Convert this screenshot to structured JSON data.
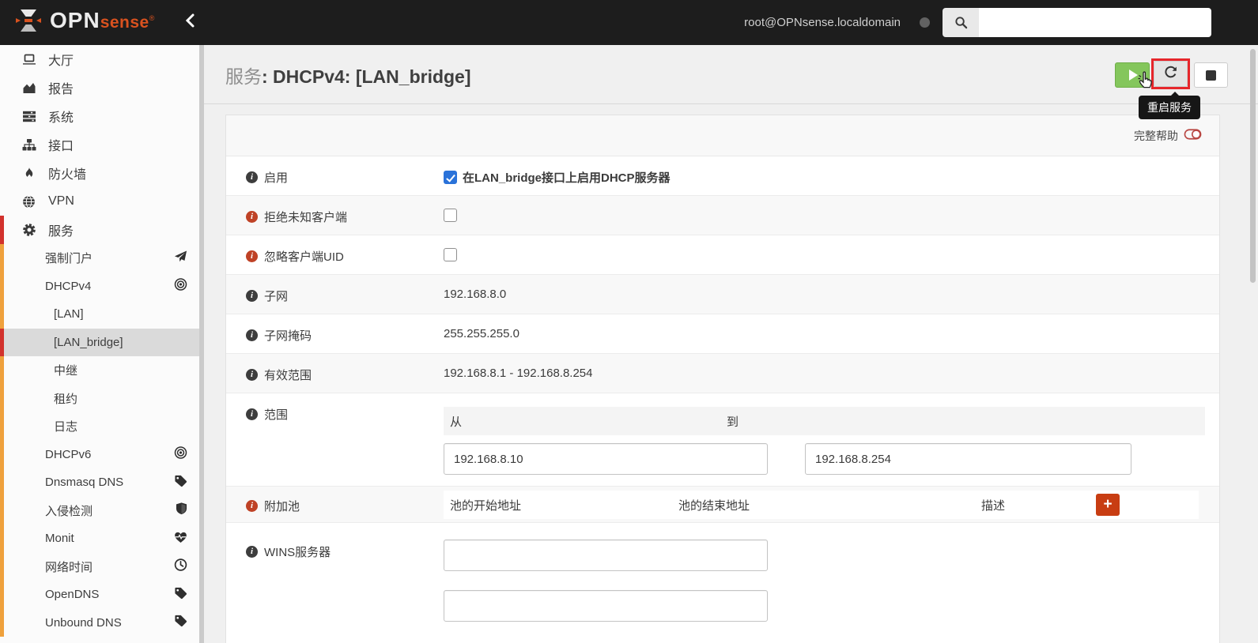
{
  "topbar": {
    "brand_opn": "OPN",
    "brand_sense": "sense",
    "brand_reg": "®",
    "user": "root@OPNsense.localdomain",
    "search_value": ""
  },
  "sidebar": {
    "items": [
      {
        "label": "大厅",
        "icon": "laptop"
      },
      {
        "label": "报告",
        "icon": "area-chart"
      },
      {
        "label": "系统",
        "icon": "tasks"
      },
      {
        "label": "接口",
        "icon": "sitemap"
      },
      {
        "label": "防火墙",
        "icon": "fire"
      },
      {
        "label": "VPN",
        "icon": "globe"
      },
      {
        "label": "服务",
        "icon": "gear",
        "active": true
      }
    ],
    "submenu": [
      {
        "label": "强制门户",
        "icon": "paper-plane"
      },
      {
        "label": "DHCPv4",
        "icon": "bullseye"
      },
      {
        "label": "[LAN]",
        "level": 2
      },
      {
        "label": "[LAN_bridge]",
        "level": 2,
        "selected": true
      },
      {
        "label": "中继",
        "level": 2
      },
      {
        "label": "租约",
        "level": 2
      },
      {
        "label": "日志",
        "level": 2
      },
      {
        "label": "DHCPv6",
        "icon": "bullseye"
      },
      {
        "label": "Dnsmasq DNS",
        "icon": "tag"
      },
      {
        "label": "入侵检测",
        "icon": "shield"
      },
      {
        "label": "Monit",
        "icon": "heartbeat"
      },
      {
        "label": "网络时间",
        "icon": "clock"
      },
      {
        "label": "OpenDNS",
        "icon": "tag"
      },
      {
        "label": "Unbound DNS",
        "icon": "tag"
      }
    ]
  },
  "header": {
    "title_prefix": "服务",
    "title_rest": ": DHCPv4: [LAN_bridge]",
    "restart_tooltip": "重启服务"
  },
  "form": {
    "full_help": "完整帮助",
    "enable": {
      "label": "启用",
      "text": "在LAN_bridge接口上启用DHCP服务器",
      "checked": true
    },
    "deny_unknown": {
      "label": "拒绝未知客户端",
      "checked": false
    },
    "ignore_uid": {
      "label": "忽略客户端UID",
      "checked": false
    },
    "subnet": {
      "label": "子网",
      "value": "192.168.8.0"
    },
    "subnet_mask": {
      "label": "子网掩码",
      "value": "255.255.255.0"
    },
    "available_range": {
      "label": "有效范围",
      "value": "192.168.8.1 - 192.168.8.254"
    },
    "range": {
      "label": "范围",
      "from_label": "从",
      "to_label": "到",
      "from_value": "192.168.8.10",
      "to_value": "192.168.8.254"
    },
    "additional_pools": {
      "label": "附加池",
      "col_start": "池的开始地址",
      "col_end": "池的结束地址",
      "col_desc": "描述",
      "add_label": "+"
    },
    "wins": {
      "label": "WINS服务器",
      "value1": "",
      "value2": ""
    }
  },
  "colors": {
    "accent_orange": "#d9521f",
    "active_red": "#d2322d",
    "submenu_orange": "#efa13c",
    "success_green": "#84c65c",
    "add_button": "#c83d12",
    "annotation_red": "#e6262b",
    "checkbox_blue": "#2a72d9",
    "help_toggle_red": "#b94743"
  }
}
